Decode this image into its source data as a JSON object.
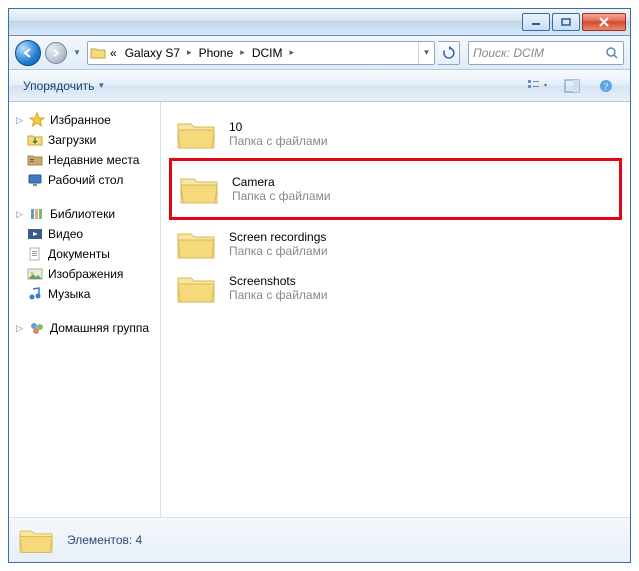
{
  "titlebar": {},
  "nav": {
    "breadcrumbs_prefix": "«",
    "crumbs": [
      "Galaxy S7",
      "Phone",
      "DCIM"
    ],
    "search_placeholder": "Поиск: DCIM"
  },
  "toolbar": {
    "organize_label": "Упорядочить"
  },
  "sidebar": {
    "favorites": {
      "label": "Избранное",
      "items": [
        {
          "label": "Загрузки",
          "icon": "downloads"
        },
        {
          "label": "Недавние места",
          "icon": "recent"
        },
        {
          "label": "Рабочий стол",
          "icon": "desktop"
        }
      ]
    },
    "libraries": {
      "label": "Библиотеки",
      "items": [
        {
          "label": "Видео",
          "icon": "videos"
        },
        {
          "label": "Документы",
          "icon": "documents"
        },
        {
          "label": "Изображения",
          "icon": "pictures"
        },
        {
          "label": "Музыка",
          "icon": "music"
        }
      ]
    },
    "homegroup": {
      "label": "Домашняя группа"
    }
  },
  "folders": [
    {
      "name": "10",
      "subtitle": "Папка с файлами",
      "highlight": false
    },
    {
      "name": "Camera",
      "subtitle": "Папка с файлами",
      "highlight": true
    },
    {
      "name": "Screen recordings",
      "subtitle": "Папка с файлами",
      "highlight": false
    },
    {
      "name": "Screenshots",
      "subtitle": "Папка с файлами",
      "highlight": false
    }
  ],
  "status": {
    "text": "Элементов: 4"
  },
  "colors": {
    "highlight_border": "#e30613"
  }
}
